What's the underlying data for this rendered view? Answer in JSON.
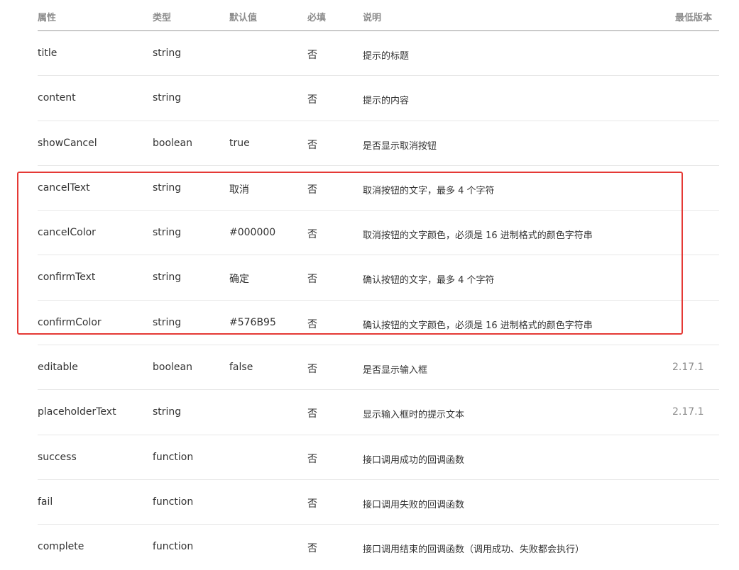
{
  "header": {
    "attr": "属性",
    "type": "类型",
    "default": "默认值",
    "required": "必填",
    "desc": "说明",
    "version": "最低版本"
  },
  "rows": [
    {
      "attr": "title",
      "type": "string",
      "default": "",
      "required": "否",
      "desc": "提示的标题",
      "version": ""
    },
    {
      "attr": "content",
      "type": "string",
      "default": "",
      "required": "否",
      "desc": "提示的内容",
      "version": ""
    },
    {
      "attr": "showCancel",
      "type": "boolean",
      "default": "true",
      "required": "否",
      "desc": "是否显示取消按钮",
      "version": ""
    },
    {
      "attr": "cancelText",
      "type": "string",
      "default": "取消",
      "required": "否",
      "desc": "取消按钮的文字，最多 4 个字符",
      "version": ""
    },
    {
      "attr": "cancelColor",
      "type": "string",
      "default": "#000000",
      "required": "否",
      "desc": "取消按钮的文字颜色，必须是 16 进制格式的颜色字符串",
      "version": ""
    },
    {
      "attr": "confirmText",
      "type": "string",
      "default": "确定",
      "required": "否",
      "desc": "确认按钮的文字，最多 4 个字符",
      "version": ""
    },
    {
      "attr": "confirmColor",
      "type": "string",
      "default": "#576B95",
      "required": "否",
      "desc": "确认按钮的文字颜色，必须是 16 进制格式的颜色字符串",
      "version": ""
    },
    {
      "attr": "editable",
      "type": "boolean",
      "default": "false",
      "required": "否",
      "desc": "是否显示输入框",
      "version": "2.17.1"
    },
    {
      "attr": "placeholderText",
      "type": "string",
      "default": "",
      "required": "否",
      "desc": "显示输入框时的提示文本",
      "version": "2.17.1"
    },
    {
      "attr": "success",
      "type": "function",
      "default": "",
      "required": "否",
      "desc": "接口调用成功的回调函数",
      "version": ""
    },
    {
      "attr": "fail",
      "type": "function",
      "default": "",
      "required": "否",
      "desc": "接口调用失败的回调函数",
      "version": ""
    },
    {
      "attr": "complete",
      "type": "function",
      "default": "",
      "required": "否",
      "desc": "接口调用结束的回调函数（调用成功、失败都会执行）",
      "version": ""
    }
  ],
  "colors": {
    "highlight_border": "#e53935",
    "header_text": "#8c8c8c",
    "body_text": "#333333"
  }
}
